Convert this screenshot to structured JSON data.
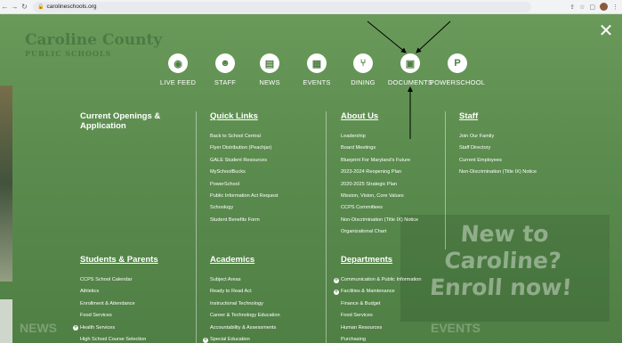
{
  "browser": {
    "url": "carolineschools.org"
  },
  "background": {
    "logo_line1": "Caroline County",
    "logo_line2": "PUBLIC SCHOOLS",
    "news": "NEWS",
    "events": "EVENTS",
    "promo_line1": "New to Caroline?",
    "promo_line2": "Enroll now!"
  },
  "quick_links": [
    {
      "label": "LIVE FEED",
      "icon": "rss-icon"
    },
    {
      "label": "STAFF",
      "icon": "people-icon"
    },
    {
      "label": "NEWS",
      "icon": "newspaper-icon"
    },
    {
      "label": "EVENTS",
      "icon": "calendar-icon"
    },
    {
      "label": "DINING",
      "icon": "utensils-icon"
    },
    {
      "label": "DOCUMENTS",
      "icon": "document-icon"
    },
    {
      "label": "POWERSCHOOL",
      "icon": "powerschool-icon"
    }
  ],
  "menu": {
    "openings": {
      "heading": "Current Openings & Application"
    },
    "quick": {
      "heading": "Quick Links",
      "items": [
        "Back to School Central",
        "Flyer Distribution (Peachjar)",
        "GALE Student Resources",
        "MySchoolBucks",
        "PowerSchool",
        "Public Information Act Request",
        "Schoology",
        "Student Benefits Form"
      ]
    },
    "about": {
      "heading": "About Us",
      "items": [
        "Leadership",
        "Board Meetings",
        "Blueprint For Maryland's Future",
        "2023-2024 Reopening Plan",
        "2020-2025 Strategic Plan",
        "Mission, Vision, Core Values",
        "CCPS Committees",
        "Non-Discrimination (Title IX) Notice",
        "Organizational Chart"
      ]
    },
    "staff": {
      "heading": "Staff",
      "items": [
        "Join Our Family",
        "Staff Directory",
        "Current Employees",
        "Non-Discrimination (Title IX) Notice"
      ]
    },
    "students": {
      "heading": "Students & Parents",
      "items": [
        "CCPS School Calendar",
        "Athletics",
        "Enrollment & Attendance",
        "Food Services",
        "Health Services",
        "High School Course Selection"
      ]
    },
    "academics": {
      "heading": "Academics",
      "items": [
        "Subject Areas",
        "Ready to Read Act",
        "Instructional Technology",
        "Career & Technology Education",
        "Accountability & Assessments",
        "Special Education"
      ]
    },
    "departments": {
      "heading": "Departments",
      "items": [
        "Communication & Public Information",
        "Facilities & Maintenance",
        "Finance & Budget",
        "Food Services",
        "Human Resources",
        "Purchasing"
      ]
    }
  }
}
